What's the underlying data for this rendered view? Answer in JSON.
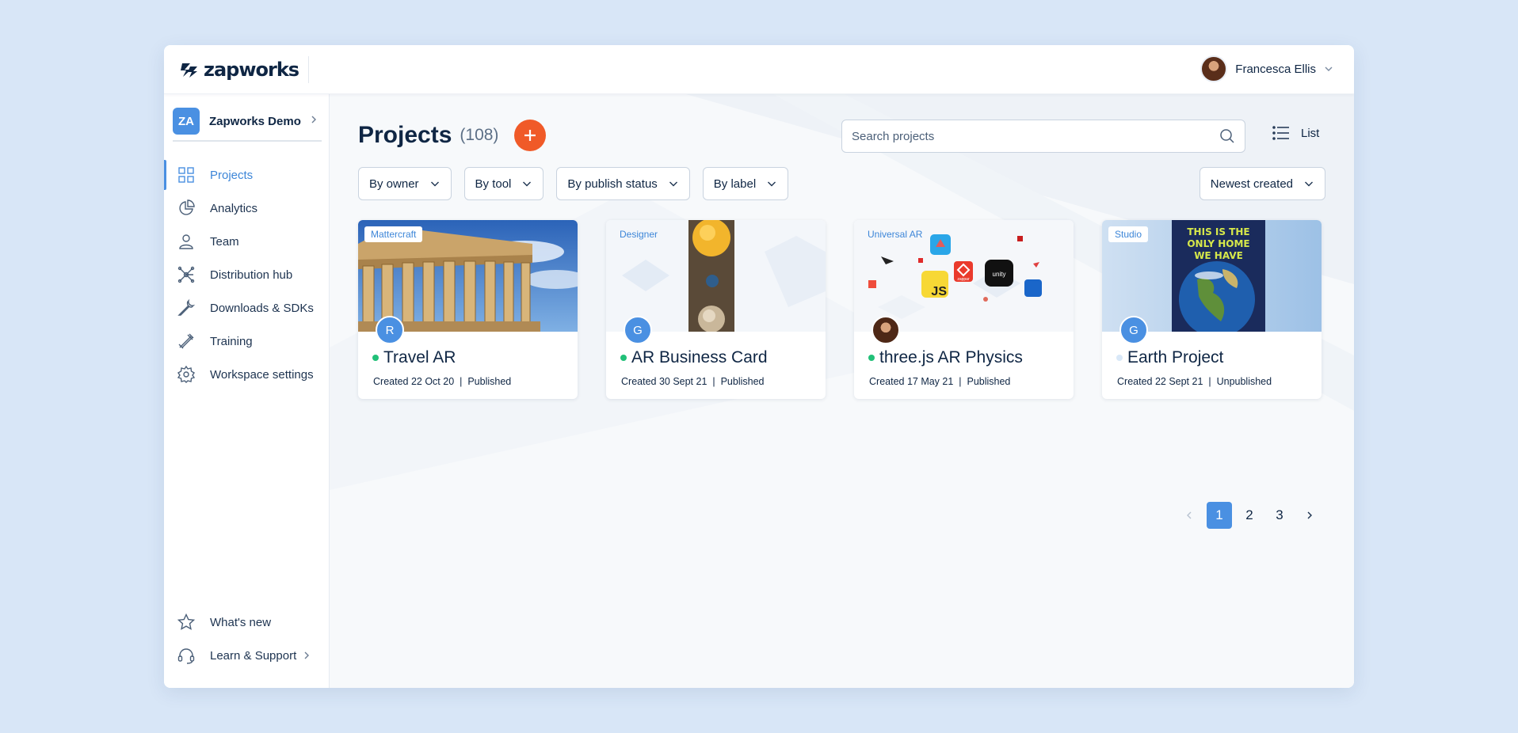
{
  "app": {
    "logo_text": "zapworks"
  },
  "user": {
    "name": "Francesca Ellis"
  },
  "workspace": {
    "badge": "ZA",
    "name": "Zapworks Demo"
  },
  "sidebar": {
    "items": [
      {
        "label": "Projects",
        "icon": "grid-icon",
        "active": true
      },
      {
        "label": "Analytics",
        "icon": "pie-chart-icon"
      },
      {
        "label": "Team",
        "icon": "person-icon"
      },
      {
        "label": "Distribution hub",
        "icon": "network-icon"
      },
      {
        "label": "Downloads & SDKs",
        "icon": "wrench-icon"
      },
      {
        "label": "Training",
        "icon": "training-icon"
      },
      {
        "label": "Workspace settings",
        "icon": "gear-icon"
      }
    ],
    "bottom": [
      {
        "label": "What's new",
        "icon": "star-icon"
      },
      {
        "label": "Learn & Support",
        "icon": "headset-icon"
      }
    ]
  },
  "main": {
    "title": "Projects",
    "count": "(108)",
    "search_placeholder": "Search projects",
    "view_label": "List",
    "filters": [
      "By owner",
      "By tool",
      "By publish status",
      "By label"
    ],
    "sort_label": "Newest created"
  },
  "projects": [
    {
      "tool": "Mattercraft",
      "owner": "R",
      "title": "Travel AR",
      "created": "Created 22 Oct 20",
      "status": "Published"
    },
    {
      "tool": "Designer",
      "owner": "G",
      "title": "AR Business Card",
      "created": "Created 30 Sept 21",
      "status": "Published"
    },
    {
      "tool": "Universal AR",
      "owner": "",
      "title": "three.js AR Physics",
      "created": "Created 17 May 21",
      "status": "Published"
    },
    {
      "tool": "Studio",
      "owner": "G",
      "title": "Earth Project",
      "created": "Created 22 Sept 21",
      "status": "Unpublished",
      "thumb_text": [
        "THIS IS THE",
        "ONLY HOME",
        "WE HAVE"
      ]
    }
  ],
  "thumb_labels": {
    "unity": "unity",
    "js": "JS",
    "zappar": "zappar"
  },
  "pagination": {
    "pages": [
      "1",
      "2",
      "3"
    ],
    "current": "1"
  },
  "colors": {
    "accent": "#4a90e2",
    "add_button": "#f05a28",
    "published": "#21c078",
    "unpublished": "#d9e8f8"
  }
}
